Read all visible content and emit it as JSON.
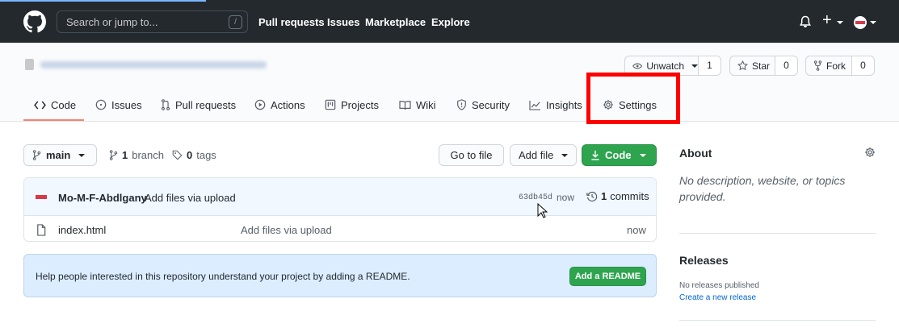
{
  "header": {
    "search_placeholder": "Search or jump to...",
    "search_shortcut": "/",
    "nav": [
      "Pull requests",
      "Issues",
      "Marketplace",
      "Explore"
    ],
    "plus_label": "+"
  },
  "repo": {
    "actions": {
      "watch": {
        "label": "Unwatch",
        "count": "1"
      },
      "star": {
        "label": "Star",
        "count": "0"
      },
      "fork": {
        "label": "Fork",
        "count": "0"
      }
    },
    "tabs": [
      {
        "label": "Code",
        "icon": "code-icon"
      },
      {
        "label": "Issues",
        "icon": "issue-icon"
      },
      {
        "label": "Pull requests",
        "icon": "pull-request-icon"
      },
      {
        "label": "Actions",
        "icon": "play-icon"
      },
      {
        "label": "Projects",
        "icon": "project-icon"
      },
      {
        "label": "Wiki",
        "icon": "book-icon"
      },
      {
        "label": "Security",
        "icon": "shield-icon"
      },
      {
        "label": "Insights",
        "icon": "graph-icon"
      },
      {
        "label": "Settings",
        "icon": "gear-icon"
      }
    ],
    "highlight_color": "#ff0000"
  },
  "toolbar": {
    "branch": "main",
    "branch_count": "1",
    "branch_word": "branch",
    "tag_count": "0",
    "tag_word": "tags",
    "go_to_file": "Go to file",
    "add_file": "Add file",
    "code": "Code"
  },
  "commit": {
    "author": "Mo-M-F-Abdlgany",
    "message": "Add files via upload",
    "sha": "63db45d",
    "time": "now",
    "count": "1",
    "count_word": "commits"
  },
  "files": [
    {
      "name": "index.html",
      "message": "Add files via upload",
      "age": "now"
    }
  ],
  "readme": {
    "text": "Help people interested in this repository understand your project by adding a README.",
    "button": "Add a README"
  },
  "sidebar": {
    "about_title": "About",
    "about_text": "No description, website, or topics provided.",
    "releases_title": "Releases",
    "releases_text": "No releases published",
    "create_release": "Create a new release"
  },
  "colors": {
    "header_bg": "#24292e",
    "primary_green": "#2ea44f",
    "tab_underline": "#f9826c",
    "link_blue": "#0366d6"
  }
}
